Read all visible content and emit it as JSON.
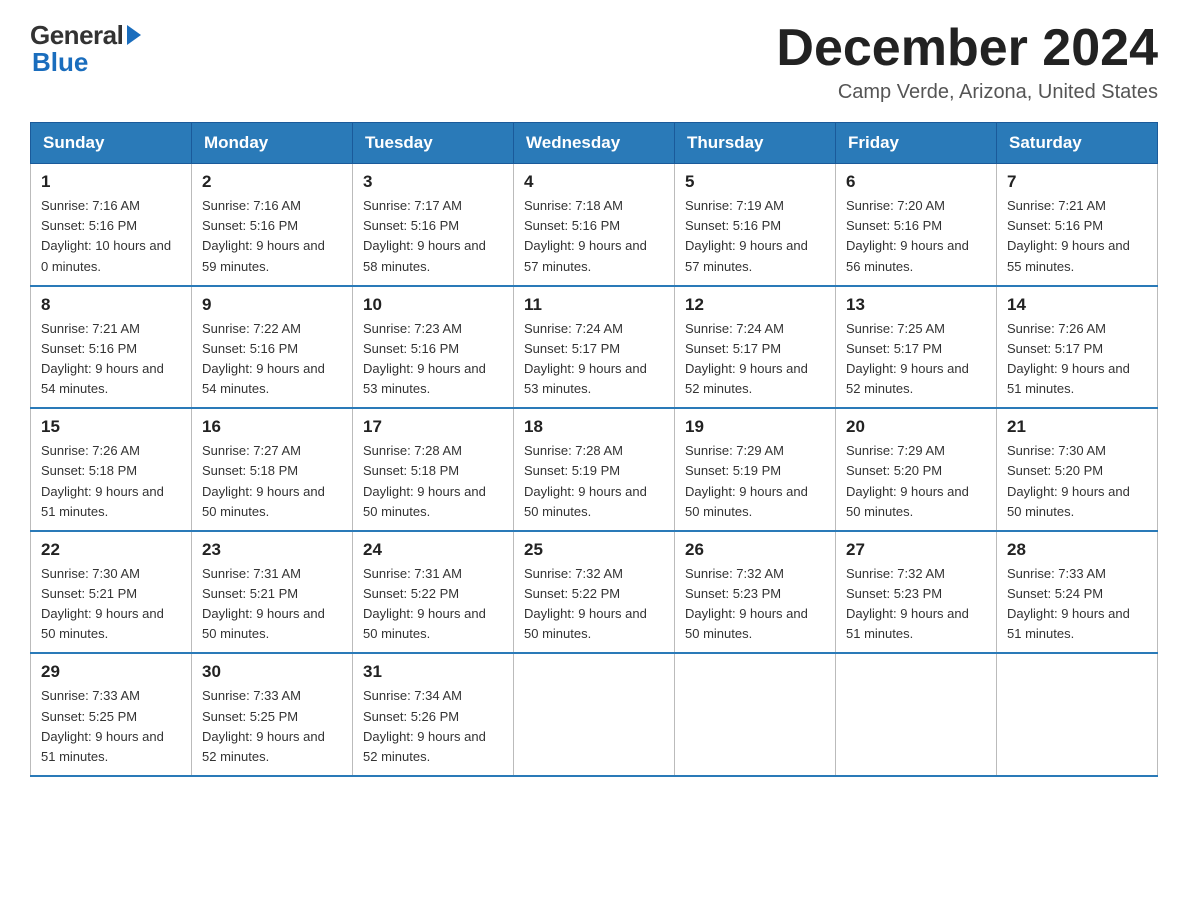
{
  "header": {
    "logo_general": "General",
    "logo_blue": "Blue",
    "title": "December 2024",
    "location": "Camp Verde, Arizona, United States"
  },
  "days_of_week": [
    "Sunday",
    "Monday",
    "Tuesday",
    "Wednesday",
    "Thursday",
    "Friday",
    "Saturday"
  ],
  "weeks": [
    [
      {
        "day": "1",
        "sunrise": "7:16 AM",
        "sunset": "5:16 PM",
        "daylight": "10 hours and 0 minutes."
      },
      {
        "day": "2",
        "sunrise": "7:16 AM",
        "sunset": "5:16 PM",
        "daylight": "9 hours and 59 minutes."
      },
      {
        "day": "3",
        "sunrise": "7:17 AM",
        "sunset": "5:16 PM",
        "daylight": "9 hours and 58 minutes."
      },
      {
        "day": "4",
        "sunrise": "7:18 AM",
        "sunset": "5:16 PM",
        "daylight": "9 hours and 57 minutes."
      },
      {
        "day": "5",
        "sunrise": "7:19 AM",
        "sunset": "5:16 PM",
        "daylight": "9 hours and 57 minutes."
      },
      {
        "day": "6",
        "sunrise": "7:20 AM",
        "sunset": "5:16 PM",
        "daylight": "9 hours and 56 minutes."
      },
      {
        "day": "7",
        "sunrise": "7:21 AM",
        "sunset": "5:16 PM",
        "daylight": "9 hours and 55 minutes."
      }
    ],
    [
      {
        "day": "8",
        "sunrise": "7:21 AM",
        "sunset": "5:16 PM",
        "daylight": "9 hours and 54 minutes."
      },
      {
        "day": "9",
        "sunrise": "7:22 AM",
        "sunset": "5:16 PM",
        "daylight": "9 hours and 54 minutes."
      },
      {
        "day": "10",
        "sunrise": "7:23 AM",
        "sunset": "5:16 PM",
        "daylight": "9 hours and 53 minutes."
      },
      {
        "day": "11",
        "sunrise": "7:24 AM",
        "sunset": "5:17 PM",
        "daylight": "9 hours and 53 minutes."
      },
      {
        "day": "12",
        "sunrise": "7:24 AM",
        "sunset": "5:17 PM",
        "daylight": "9 hours and 52 minutes."
      },
      {
        "day": "13",
        "sunrise": "7:25 AM",
        "sunset": "5:17 PM",
        "daylight": "9 hours and 52 minutes."
      },
      {
        "day": "14",
        "sunrise": "7:26 AM",
        "sunset": "5:17 PM",
        "daylight": "9 hours and 51 minutes."
      }
    ],
    [
      {
        "day": "15",
        "sunrise": "7:26 AM",
        "sunset": "5:18 PM",
        "daylight": "9 hours and 51 minutes."
      },
      {
        "day": "16",
        "sunrise": "7:27 AM",
        "sunset": "5:18 PM",
        "daylight": "9 hours and 50 minutes."
      },
      {
        "day": "17",
        "sunrise": "7:28 AM",
        "sunset": "5:18 PM",
        "daylight": "9 hours and 50 minutes."
      },
      {
        "day": "18",
        "sunrise": "7:28 AM",
        "sunset": "5:19 PM",
        "daylight": "9 hours and 50 minutes."
      },
      {
        "day": "19",
        "sunrise": "7:29 AM",
        "sunset": "5:19 PM",
        "daylight": "9 hours and 50 minutes."
      },
      {
        "day": "20",
        "sunrise": "7:29 AM",
        "sunset": "5:20 PM",
        "daylight": "9 hours and 50 minutes."
      },
      {
        "day": "21",
        "sunrise": "7:30 AM",
        "sunset": "5:20 PM",
        "daylight": "9 hours and 50 minutes."
      }
    ],
    [
      {
        "day": "22",
        "sunrise": "7:30 AM",
        "sunset": "5:21 PM",
        "daylight": "9 hours and 50 minutes."
      },
      {
        "day": "23",
        "sunrise": "7:31 AM",
        "sunset": "5:21 PM",
        "daylight": "9 hours and 50 minutes."
      },
      {
        "day": "24",
        "sunrise": "7:31 AM",
        "sunset": "5:22 PM",
        "daylight": "9 hours and 50 minutes."
      },
      {
        "day": "25",
        "sunrise": "7:32 AM",
        "sunset": "5:22 PM",
        "daylight": "9 hours and 50 minutes."
      },
      {
        "day": "26",
        "sunrise": "7:32 AM",
        "sunset": "5:23 PM",
        "daylight": "9 hours and 50 minutes."
      },
      {
        "day": "27",
        "sunrise": "7:32 AM",
        "sunset": "5:23 PM",
        "daylight": "9 hours and 51 minutes."
      },
      {
        "day": "28",
        "sunrise": "7:33 AM",
        "sunset": "5:24 PM",
        "daylight": "9 hours and 51 minutes."
      }
    ],
    [
      {
        "day": "29",
        "sunrise": "7:33 AM",
        "sunset": "5:25 PM",
        "daylight": "9 hours and 51 minutes."
      },
      {
        "day": "30",
        "sunrise": "7:33 AM",
        "sunset": "5:25 PM",
        "daylight": "9 hours and 52 minutes."
      },
      {
        "day": "31",
        "sunrise": "7:34 AM",
        "sunset": "5:26 PM",
        "daylight": "9 hours and 52 minutes."
      },
      null,
      null,
      null,
      null
    ]
  ]
}
